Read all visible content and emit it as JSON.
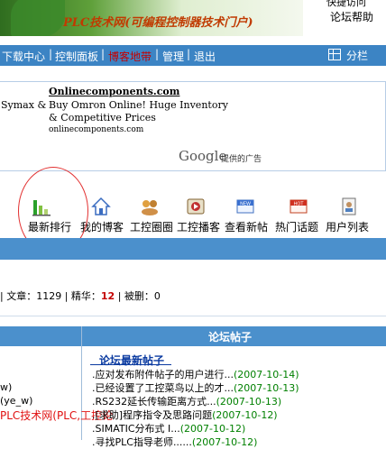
{
  "banner": {
    "title": "PLC技术网(可编程控制器技术门户)"
  },
  "top_links": {
    "partial": "快捷访问",
    "help": "论坛帮助"
  },
  "nav": {
    "items": [
      "下载中心",
      "控制面板",
      "博客地带",
      "管理",
      "退出"
    ],
    "active_index": 2,
    "toggle_label": "分栏"
  },
  "ad": {
    "left_text": "Symax &",
    "title": "Onlinecomponents.com",
    "body": "Buy Omron Online! Huge Inventory & Competitive Prices",
    "url": "onlinecomponents.com",
    "google": "Google",
    "google_sub": "提供的广告"
  },
  "icon_tabs": [
    {
      "label": "最新排行",
      "icon": "ranking-chart-icon"
    },
    {
      "label": "我的博客",
      "icon": "home-icon"
    },
    {
      "label": "工控圈圈",
      "icon": "users-group-icon"
    },
    {
      "label": "工控播客",
      "icon": "media-player-icon"
    },
    {
      "label": "查看新帖",
      "icon": "new-badge-icon"
    },
    {
      "label": "热门话题",
      "icon": "hot-badge-icon"
    },
    {
      "label": "用户列表",
      "icon": "user-list-icon"
    }
  ],
  "stats": {
    "articles_label": "| 文章：",
    "articles": "1129",
    "elite_label": "| 精华：",
    "elite": "12",
    "deleted_label": "| 被删：",
    "deleted": "0"
  },
  "forum": {
    "header": "论坛帖子",
    "latest_title": "论坛最新帖子",
    "left_items": [
      "w)",
      "(ye_w)",
      "PLC技术网(PLC,工控论"
    ],
    "posts": [
      {
        "title": ".应对发布附件帖子的用户进行...",
        "date": "(2007-10-14)"
      },
      {
        "title": ".已经设置了工控菜鸟以上的才...",
        "date": "(2007-10-13)"
      },
      {
        "title": ".RS232延长传输距离方式...",
        "date": "(2007-10-13)"
      },
      {
        "title": ".[求助]程序指令及思路问题",
        "date": "(2007-10-12)"
      },
      {
        "title": ".SIMATIC分布式 I...",
        "date": "(2007-10-12)"
      },
      {
        "title": ".寻找PLC指导老师......",
        "date": "(2007-10-12)"
      }
    ]
  }
}
